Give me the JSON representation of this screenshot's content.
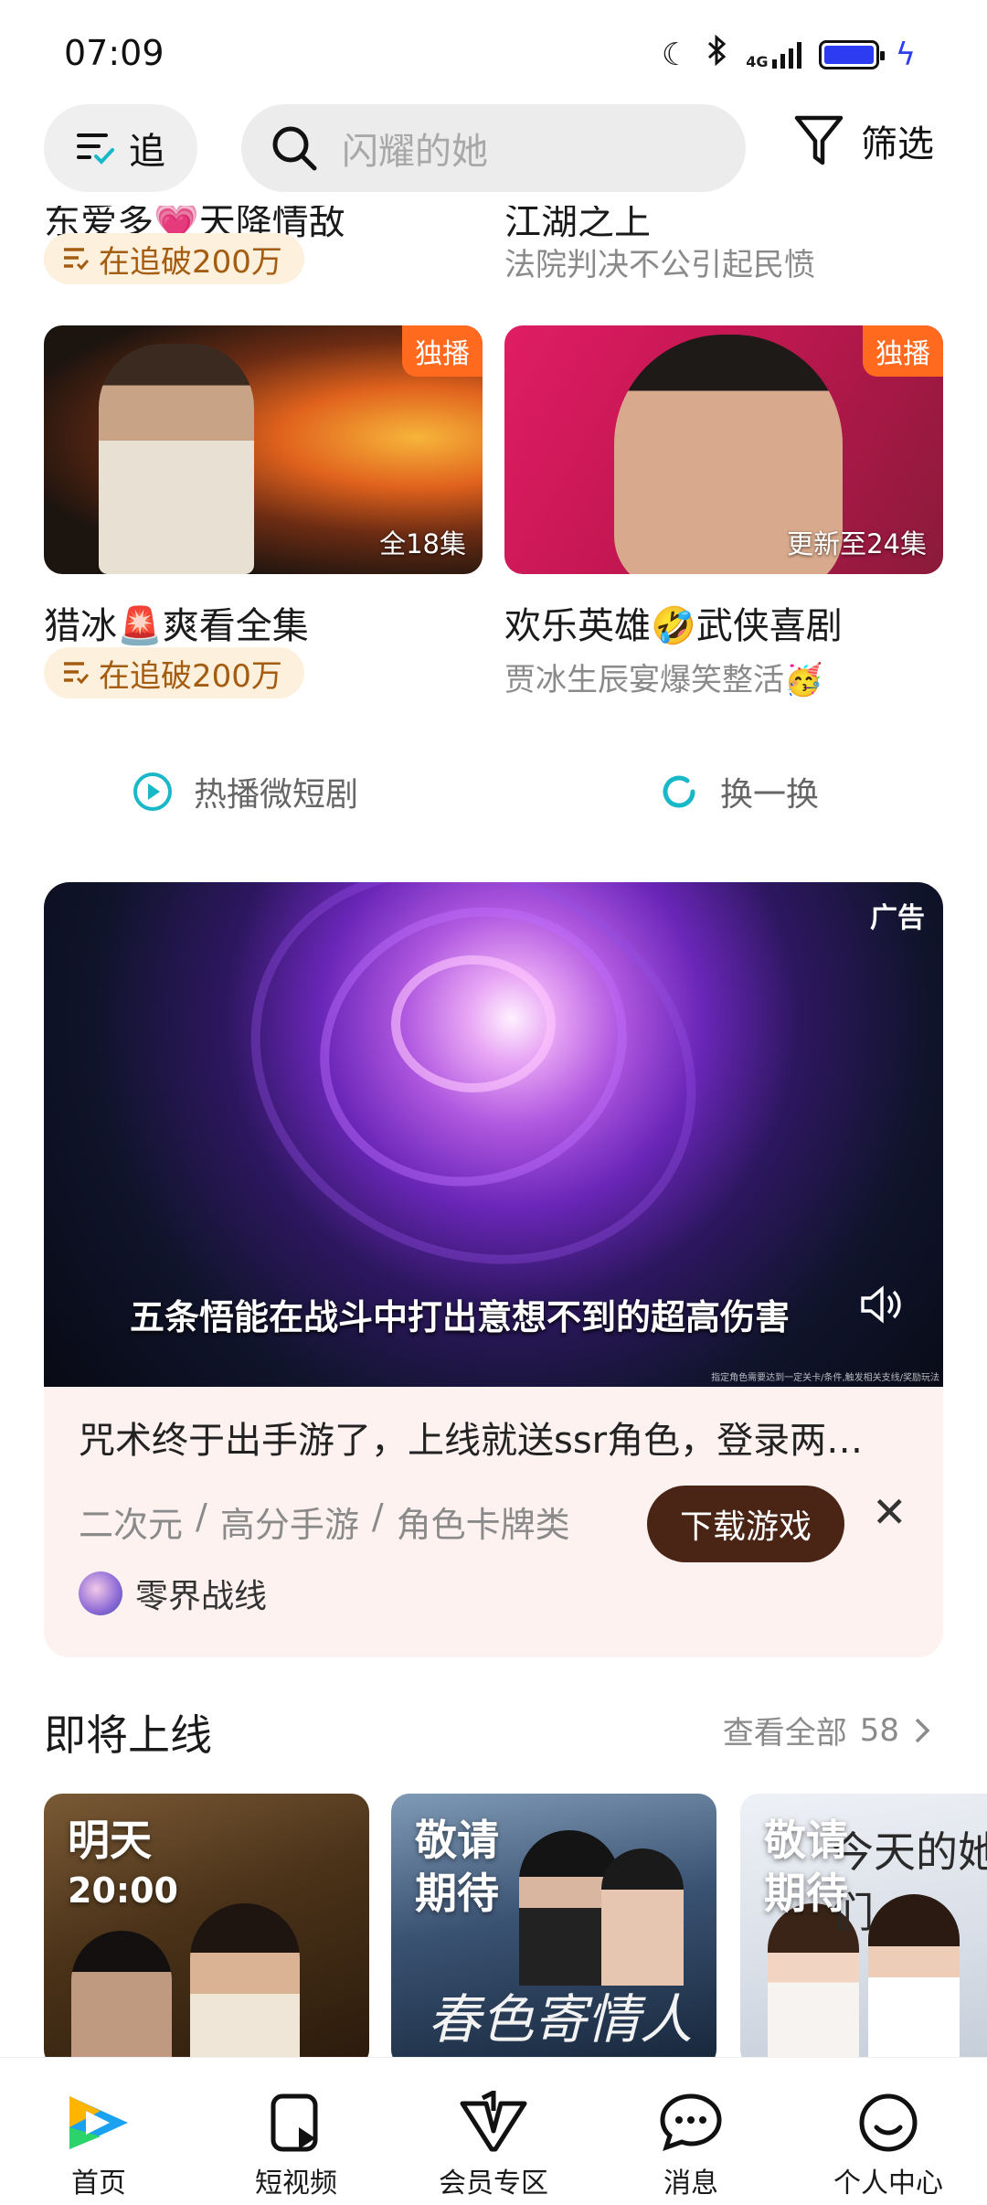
{
  "status_bar": {
    "time": "07:09",
    "network": "4G"
  },
  "top_nav": {
    "chase_label": "追",
    "search_placeholder": "闪耀的她",
    "filter_label": "筛选"
  },
  "partial_row": {
    "left_title": "东爱多💗天降情敌",
    "left_badge": "在追破200万",
    "right_title": "江湖之上",
    "right_subtitle": "法院判决不公引起民愤"
  },
  "dramas": [
    {
      "title": "猎冰🚨爽看全集",
      "tag": "独播",
      "episodes": "全18集",
      "badge": "在追破200万"
    },
    {
      "title": "欢乐英雄🤣武侠喜剧",
      "tag": "独播",
      "episodes": "更新至24集",
      "subtitle": "贾冰生辰宴爆笑整活🥳"
    }
  ],
  "links": {
    "hot_short": "热播微短剧",
    "refresh": "换一换"
  },
  "ad": {
    "tag": "广告",
    "caption": "五条悟能在战斗中打出意想不到的超高伤害",
    "fineprint": "指定角色需要达到一定关卡/条件,触发相关支线/奖励玩法",
    "description": "咒术终于出手游了，上线就送ssr角色，登录两…",
    "tags": [
      "二次元",
      "/",
      "高分手游",
      "/",
      "角色卡牌类"
    ],
    "download_label": "下载游戏",
    "close_symbol": "✕",
    "advertiser": "零界战线"
  },
  "coming_soon": {
    "title": "即将上线",
    "view_all": "查看全部",
    "count": "58",
    "posters": [
      {
        "label": "明天",
        "time": "20:00"
      },
      {
        "label": "敬请\n期待",
        "art_text": "春色寄情人"
      },
      {
        "label": "敬请\n期待",
        "art_text": "今天的她们"
      }
    ]
  },
  "bottom_nav": [
    {
      "label": "首页",
      "active": true
    },
    {
      "label": "短视频"
    },
    {
      "label": "会员专区"
    },
    {
      "label": "消息"
    },
    {
      "label": "个人中心"
    }
  ],
  "colors": {
    "accent_teal": "#18b8c8",
    "badge_bg": "#fdf0dc",
    "badge_text": "#a45c10",
    "exclusive": "#ff6a1f",
    "download": "#4a2516"
  }
}
